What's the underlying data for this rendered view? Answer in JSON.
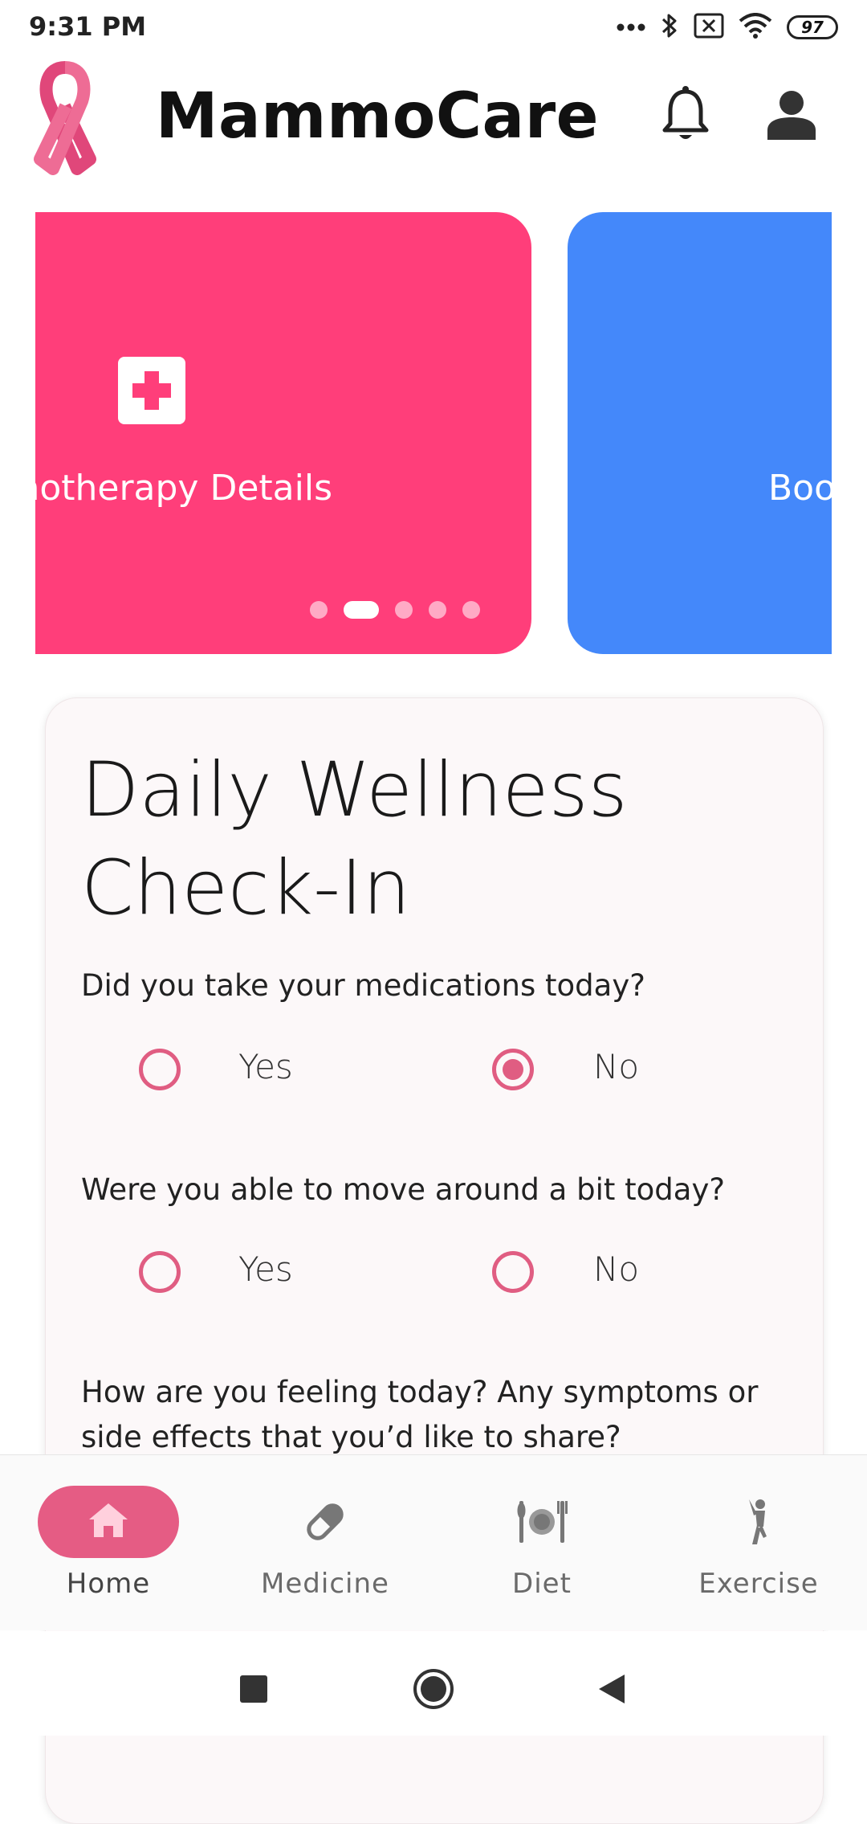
{
  "status_bar": {
    "time": "9:31 PM",
    "battery": "97"
  },
  "header": {
    "title": "MammoCare"
  },
  "carousel": {
    "cards": [
      {
        "label": "motherapy Details",
        "color": "#ff3e7a",
        "icon": "medical-cross-icon"
      },
      {
        "label": "Boo",
        "color": "#4488fa"
      }
    ],
    "dot_count": 5,
    "active_dot_index": 1
  },
  "wellness": {
    "title_line1": "Daily Wellness",
    "title_line2": "Check-In",
    "q1": {
      "text": "Did you take your medications today?",
      "yes": "Yes",
      "no": "No",
      "selected": "No"
    },
    "q2": {
      "text": "Were you able to move around a bit today?",
      "yes": "Yes",
      "no": "No",
      "selected": null
    },
    "q3": {
      "text_line1": "How are you feeling today? Any symptoms or",
      "text_line2": "side effects that you’d like to share?"
    }
  },
  "bottom_nav": {
    "items": [
      {
        "label": "Home",
        "icon": "home-icon",
        "active": true
      },
      {
        "label": "Medicine",
        "icon": "pill-icon",
        "active": false
      },
      {
        "label": "Diet",
        "icon": "dining-icon",
        "active": false
      },
      {
        "label": "Exercise",
        "icon": "exercise-icon",
        "active": false
      }
    ]
  },
  "colors": {
    "accent": "#e55c84",
    "radio": "#e05d82",
    "pink_card": "#ff3e7a",
    "blue_card": "#4488fa"
  }
}
